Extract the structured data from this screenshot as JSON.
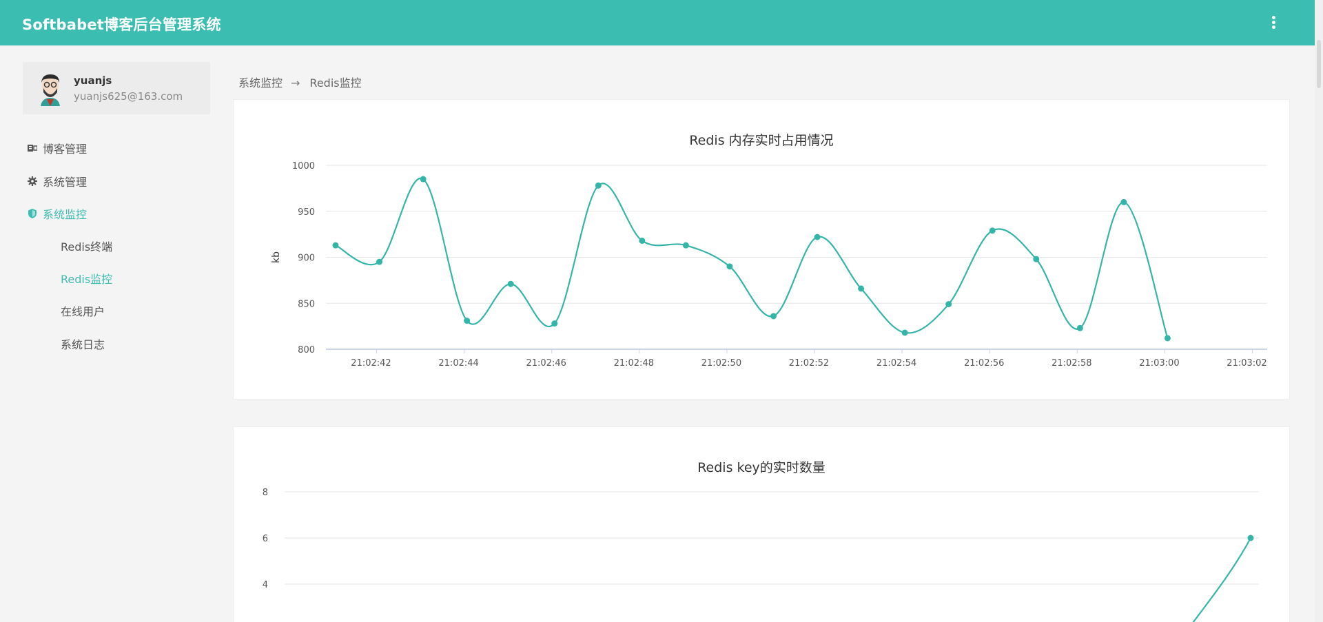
{
  "app": {
    "title": "Softbabet博客后台管理系统"
  },
  "header": {
    "menu_icon": "more-vert-icon"
  },
  "user": {
    "name": "yuanjs",
    "email": "yuanjs625@163.com",
    "avatar_icon": "user-avatar"
  },
  "sidebar": {
    "items": [
      {
        "label": "博客管理",
        "icon": "blog-icon"
      },
      {
        "label": "系统管理",
        "icon": "gear-icon"
      },
      {
        "label": "系统监控",
        "icon": "shield-icon",
        "active": true
      }
    ],
    "sub_items": [
      {
        "label": "Redis终端"
      },
      {
        "label": "Redis监控",
        "active": true
      },
      {
        "label": "在线用户"
      },
      {
        "label": "系统日志"
      }
    ]
  },
  "breadcrumb": {
    "parent": "系统监控",
    "separator": "→",
    "current": "Redis监控"
  },
  "colors": {
    "accent": "#3bbdb1",
    "line": "#35b5a8"
  },
  "chart_data": [
    {
      "type": "line",
      "title": "Redis 内存实时占用情况",
      "ylabel": "kb",
      "ylim": [
        800,
        1000
      ],
      "yticks": [
        800,
        850,
        900,
        950,
        1000
      ],
      "x": [
        "21:02:41",
        "21:02:42",
        "21:02:43",
        "21:02:44",
        "21:02:45",
        "21:02:46",
        "21:02:47",
        "21:02:48",
        "21:02:49",
        "21:02:50",
        "21:02:51",
        "21:02:52",
        "21:02:53",
        "21:02:54",
        "21:02:55",
        "21:02:56",
        "21:02:57",
        "21:02:58",
        "21:02:59",
        "21:03:00",
        "21:03:02"
      ],
      "xticks": [
        "21:02:42",
        "21:02:44",
        "21:02:46",
        "21:02:48",
        "21:02:50",
        "21:02:52",
        "21:02:54",
        "21:02:56",
        "21:02:58",
        "21:03:00",
        "21:03:02"
      ],
      "series": [
        {
          "values": [
            913,
            895,
            985,
            831,
            871,
            828,
            978,
            918,
            913,
            890,
            836,
            922,
            866,
            818,
            849,
            929,
            898,
            823,
            960,
            812
          ]
        }
      ],
      "grid": true
    },
    {
      "type": "line",
      "title": "Redis key的实时数量",
      "yticks": [
        4,
        6,
        8
      ],
      "series": [
        {
          "values": [
            6
          ]
        }
      ],
      "grid": true
    }
  ]
}
